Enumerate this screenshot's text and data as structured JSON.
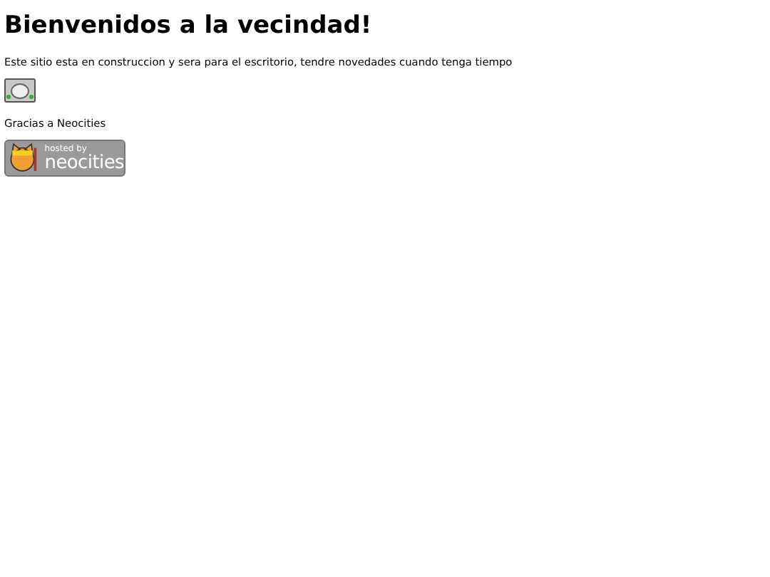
{
  "heading": "Bienvenidos a la vecindad!",
  "intro": "Este sitio esta en construccion y sera para el escritorio, tendre novedades cuando tenga tiempo",
  "thanks": "Gracias a Neocities",
  "badge": {
    "line_1": "hosted by",
    "line_2": "neocities"
  }
}
